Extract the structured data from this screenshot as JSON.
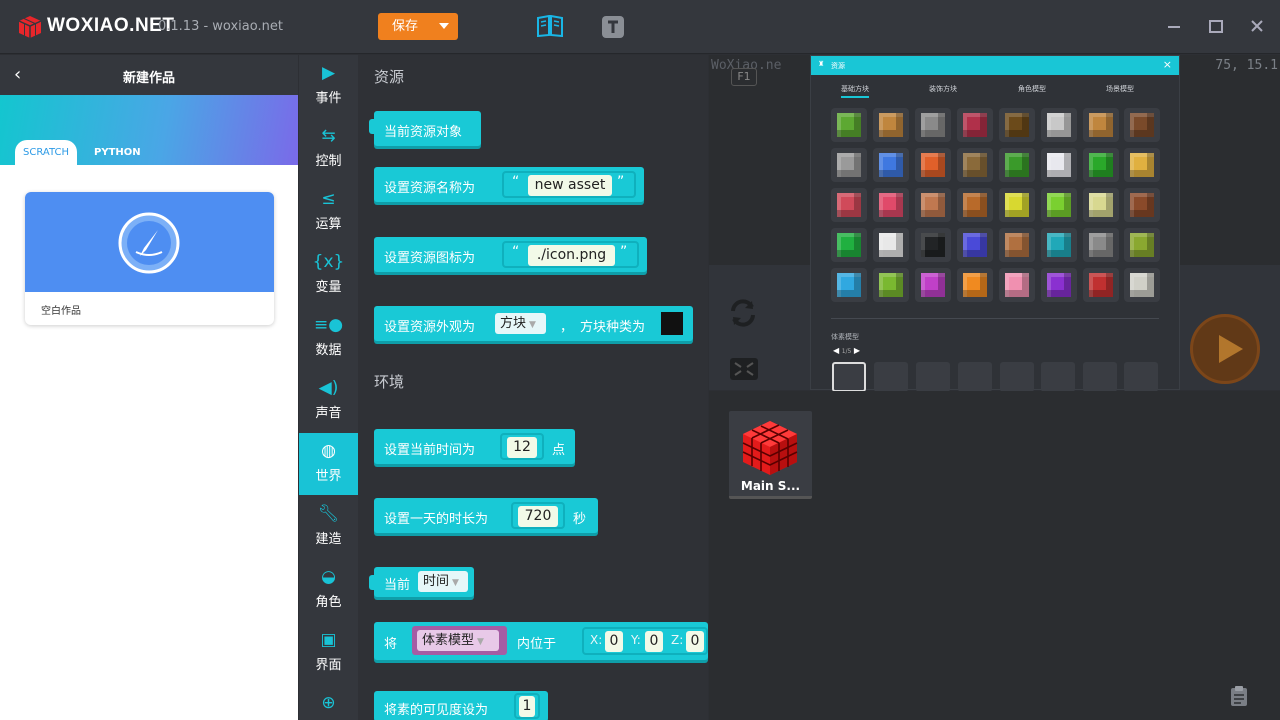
{
  "app": {
    "brand": "WOXIAO.NET",
    "version": "0.1.13 - woxiao.net",
    "save_label": "保存"
  },
  "left_panel": {
    "title": "新建作品",
    "tabs": [
      {
        "label": "SCRATCH",
        "active": true
      },
      {
        "label": "PYTHON",
        "active": false
      }
    ],
    "card_label": "空白作品"
  },
  "categories": [
    {
      "label": "事件",
      "icon": "play-icon"
    },
    {
      "label": "控制",
      "icon": "loop-icon"
    },
    {
      "label": "运算",
      "icon": "less-equal-icon"
    },
    {
      "label": "变量",
      "icon": "braces-icon"
    },
    {
      "label": "数据",
      "icon": "list-icon"
    },
    {
      "label": "声音",
      "icon": "speaker-icon"
    },
    {
      "label": "世界",
      "icon": "globe-icon",
      "active": true
    },
    {
      "label": "建造",
      "icon": "wrench-icon"
    },
    {
      "label": "角色",
      "icon": "mask-icon"
    },
    {
      "label": "界面",
      "icon": "window-icon"
    }
  ],
  "workspace": {
    "section_assets": "资源",
    "section_env": "环境",
    "b1": "当前资源对象",
    "b2": {
      "text": "设置资源名称为",
      "value": "new asset"
    },
    "b3": {
      "text": "设置资源图标为",
      "value": "./icon.png"
    },
    "b4": {
      "text": "设置资源外观为",
      "dropdown": "方块",
      "sep": "，",
      "tail": "方块种类为"
    },
    "b5": {
      "text": "设置当前时间为",
      "value": "12",
      "unit": "点"
    },
    "b6": {
      "text": "设置一天的时长为",
      "value": "720",
      "unit": "秒"
    },
    "b7": {
      "text": "当前",
      "dropdown": "时间"
    },
    "b8": {
      "text": "将",
      "dropdown": "体素模型",
      "mid": "内位于",
      "x_label": "X:",
      "x": "0",
      "y_label": "Y:",
      "y": "0",
      "z_label": "Z:",
      "z": "0"
    },
    "b9": {
      "text": "将素的可见度设为",
      "value": "1"
    }
  },
  "stage": {
    "coords_left": "WoXiao.ne",
    "coords_right": "75, 15.1",
    "f1": "F1"
  },
  "dialog": {
    "title": "资源",
    "tabs": [
      "基础方块",
      "装饰方块",
      "角色模型",
      "场景模型"
    ],
    "section": "体素模型",
    "page": "1/5"
  },
  "asset": {
    "name": "Main S..."
  }
}
